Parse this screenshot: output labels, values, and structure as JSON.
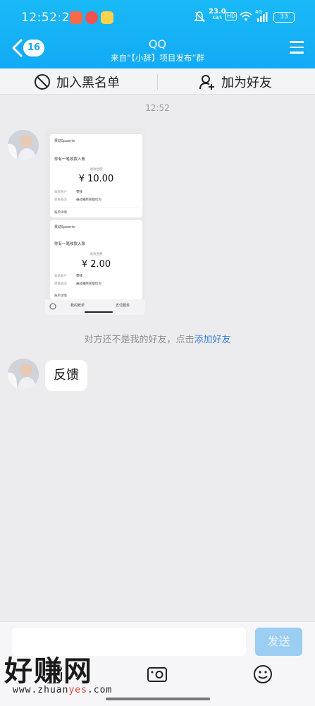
{
  "status_bar": {
    "time": "12:52:26",
    "net_speed": "23.0",
    "net_unit": "KB/S",
    "hd": "HD",
    "network": "4G",
    "battery": "33"
  },
  "header": {
    "unread_count": "16",
    "title": "QQ",
    "subtitle": "来自“【小辞】项目发布”群"
  },
  "actions": {
    "block_label": "加入黑名单",
    "add_friend_label": "加为好友"
  },
  "chat": {
    "timestamp": "12:52",
    "image_message": {
      "app_name": "果动Spoorts",
      "cards": [
        {
          "headline": "你有一笔收款入账",
          "amount_label": "收款金额",
          "amount": "¥ 10.00",
          "rows": [
            {
              "key": "收款账户",
              "value": "零钱"
            },
            {
              "key": "转账备注",
              "value": "通过抽奖获取红包"
            }
          ],
          "footer": "账单详情"
        },
        {
          "headline": "你有一笔收款入账",
          "amount_label": "收款金额",
          "amount": "¥ 2.00",
          "rows": [
            {
              "key": "收款账户",
              "value": "零钱"
            },
            {
              "key": "转账备注",
              "value": "通过抽奖获取红包"
            }
          ],
          "footer": "账单详情"
        }
      ],
      "bottom_tabs": [
        "我的账单",
        "支付服务"
      ]
    },
    "notice": "对方还不是我的好友，点击",
    "notice_link": "添加好友",
    "text_message": "反馈"
  },
  "input": {
    "send_label": "发送"
  },
  "watermark": {
    "big": "好赚网",
    "small_1": "www.zhuan",
    "small_2": "yes",
    "small_3": ".com"
  }
}
